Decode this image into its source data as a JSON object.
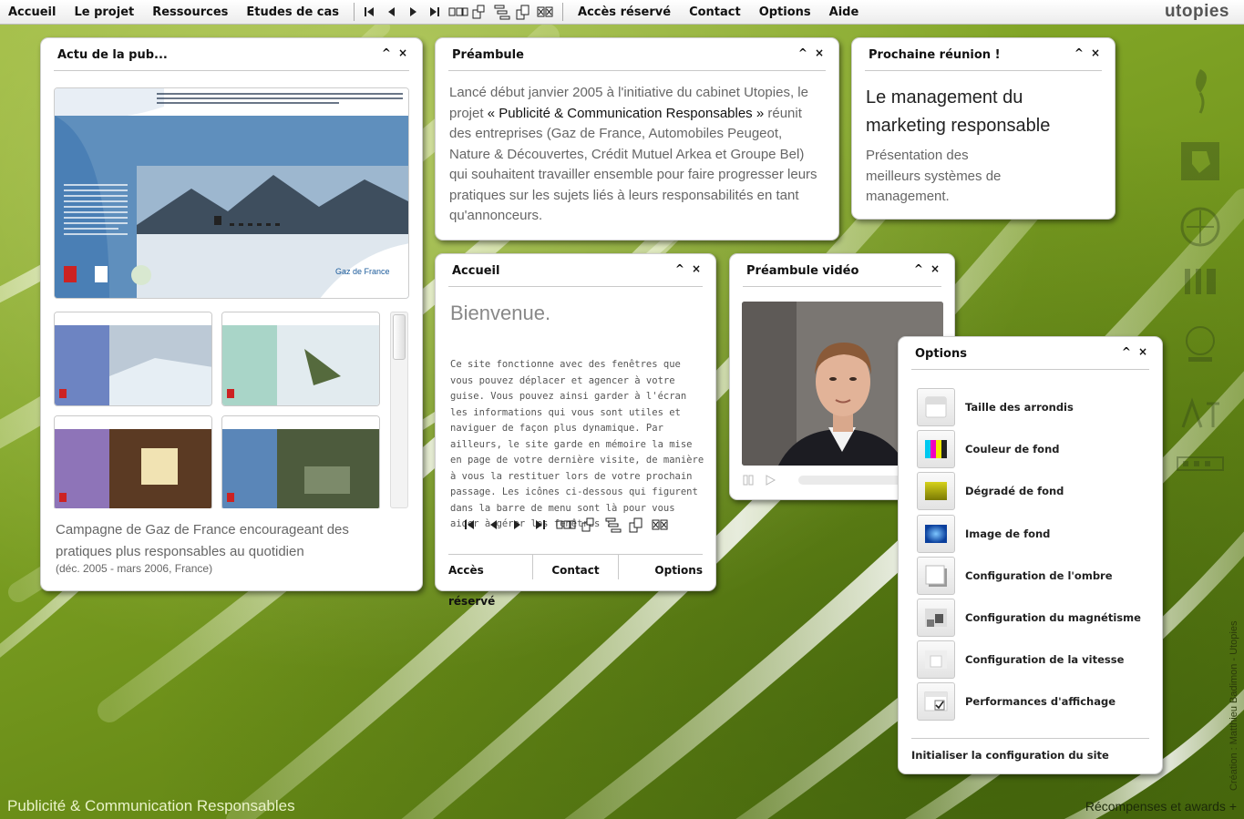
{
  "menu": {
    "left": [
      "Accueil",
      "Le projet",
      "Ressources",
      "Etudes de cas"
    ],
    "right": [
      "Accès réservé",
      "Contact",
      "Options",
      "Aide"
    ],
    "tools": [
      "first-icon",
      "prev-icon",
      "next-icon",
      "last-icon",
      "cascade-icon",
      "tile-icon",
      "tree-icon",
      "stack-icon",
      "close-all-icon"
    ]
  },
  "logo": "utopies",
  "windows": {
    "actu": {
      "title": "Actu de la pub...",
      "caption": "Campagne de Gaz de France encourageant des pratiques plus responsables au quotidien",
      "date": "(déc. 2005 - mars 2006, France)",
      "brand": "Gaz de France"
    },
    "preambule": {
      "title": "Préambule",
      "text_before": "Lancé début janvier 2005 à l'initiative du cabinet Utopies, le projet ",
      "text_project": "« Publicité & Communication Responsables »",
      "text_after": " réunit des entreprises (Gaz de France, Automobiles Peugeot, Nature & Découvertes, Crédit Mutuel Arkea et Groupe Bel) qui souhaitent travailler ensemble pour faire progresser leurs pratiques sur les sujets liés à leurs responsabilités en tant qu'annonceurs."
    },
    "reunion": {
      "title": "Prochaine réunion !",
      "heading": "Le management du marketing responsable",
      "text": "Présentation des meilleurs systèmes de management."
    },
    "accueil": {
      "title": "Accueil",
      "heading": "Bienvenue.",
      "text": "Ce site fonctionne avec des fenêtres que vous pouvez déplacer et agencer à votre guise. Vous pouvez ainsi garder à l'écran les informations qui vous sont utiles et naviguer de façon plus dynamique. Par ailleurs, le site garde en mémoire la mise en page de votre dernière visite, de manière à vous la restituer lors de votre prochain passage. Les icônes ci-dessous qui figurent dans la barre de menu sont là pour vous aider à gérer les fenêtres :",
      "footer": [
        "Accès réservé",
        "Contact",
        "Options"
      ]
    },
    "video": {
      "title": "Préambule vidéo"
    },
    "options": {
      "title": "Options",
      "items": [
        {
          "label": "Taille des arrondis",
          "icon": "rounded-corner-icon"
        },
        {
          "label": "Couleur de fond",
          "icon": "color-bars-icon"
        },
        {
          "label": "Dégradé de fond",
          "icon": "gradient-icon"
        },
        {
          "label": "Image de fond",
          "icon": "image-icon"
        },
        {
          "label": "Configuration de l'ombre",
          "icon": "shadow-icon"
        },
        {
          "label": "Configuration du magnétisme",
          "icon": "magnet-icon"
        },
        {
          "label": "Configuration de la vitesse",
          "icon": "speed-icon"
        },
        {
          "label": "Performances d'affichage",
          "icon": "performance-icon"
        }
      ],
      "reset": "Initialiser la configuration du site"
    }
  },
  "footer": {
    "left": "Publicité & Communication Responsables",
    "right": "Récompenses et awards +",
    "credit": "Création : Matthieu Badimon - Utopies"
  },
  "window_controls": {
    "minimize": "^",
    "close": "×"
  }
}
